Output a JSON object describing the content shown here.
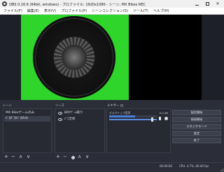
{
  "window": {
    "title": "OBS 0.16.6 (64bit, windows) - プロファイル: 1920x1080 - シーン: MX Bikes REC"
  },
  "menu": [
    "ファイル(F)",
    "編集(E)",
    "表示(V)",
    "プロファイル(P)",
    "シーンコレクション(S)",
    "ツール(T)",
    "ヘルプ(H)"
  ],
  "docks": {
    "scenes_title": "シーン",
    "sources_title": "ソース",
    "mixer_title": "ミキサー"
  },
  "scenes": [
    {
      "label": "MX Bikeゲームのみ"
    },
    {
      "label": "ﾊﾞﾛﾀﾞｽﾀｼﾞｵのみ"
    }
  ],
  "sources": [
    {
      "label": "BOYｹﾞｰﾑ取り"
    },
    {
      "label": "ﾊﾞﾛ全体"
    }
  ],
  "mixer": {
    "channel_name": "デスクトップ音声",
    "db": "0.0 dB",
    "level": 0.55,
    "volume": 0.92
  },
  "controls": [
    "配信開始",
    "録画開始",
    "スタジオモード",
    "設定",
    "終了"
  ],
  "toolbar": {
    "add": "+",
    "remove": "−",
    "up": "∧",
    "down": "∨"
  },
  "status": {
    "time": "00:00:00",
    "cpu": "CPU: 4.7%, 60.00 fps"
  },
  "colors": {
    "background": "#2b2e38",
    "green_screen": "#2fd52b",
    "accent": "#4a7fd8"
  }
}
